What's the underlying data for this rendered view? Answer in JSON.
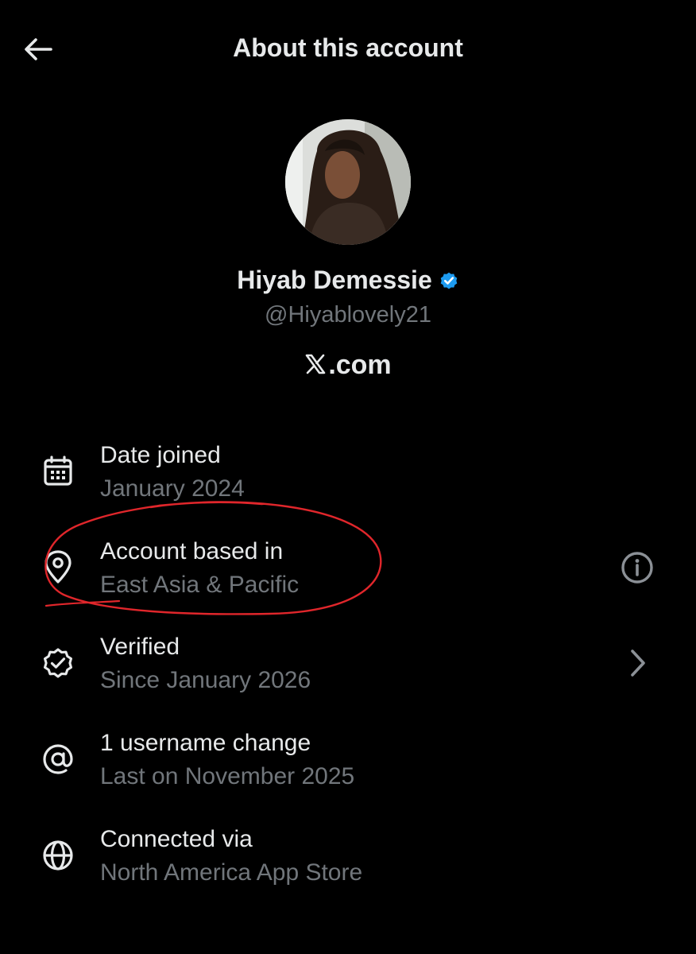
{
  "header": {
    "title": "About this account",
    "back_icon": "arrow-left-icon"
  },
  "profile": {
    "name": "Hiyab Demessie",
    "verified_badge_icon": "verified-badge-icon",
    "verified_color": "#1d9bf0",
    "handle": "@Hiyablovely21",
    "site_label": ".com",
    "site_logo_icon": "x-logo-icon"
  },
  "details": [
    {
      "icon": "calendar-icon",
      "label": "Date joined",
      "value": "January 2024"
    },
    {
      "icon": "location-pin-icon",
      "label": "Account based in",
      "value": "East Asia & Pacific",
      "trailing_icon": "info-icon"
    },
    {
      "icon": "verified-outline-icon",
      "label": "Verified",
      "value": "Since January 2026",
      "trailing_icon": "chevron-right-icon"
    },
    {
      "icon": "at-sign-icon",
      "label": "1 username change",
      "value": "Last on November 2025"
    },
    {
      "icon": "globe-icon",
      "label": "Connected via",
      "value": "North America App Store"
    }
  ],
  "colors": {
    "background": "#000000",
    "primary_text": "#e7e9ea",
    "secondary_text": "#71767b",
    "annotation": "#e0262b"
  }
}
